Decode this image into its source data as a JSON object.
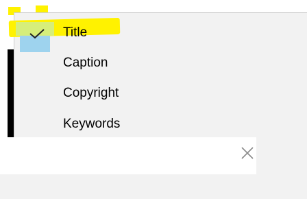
{
  "menu": {
    "items": [
      {
        "label": "Title",
        "checked": true
      },
      {
        "label": "Caption",
        "checked": false
      },
      {
        "label": "Copyright",
        "checked": false
      },
      {
        "label": "Keywords",
        "checked": false
      }
    ]
  },
  "icons": {
    "check": "check-icon",
    "close": "close-icon"
  },
  "colors": {
    "highlight": "#fff200",
    "check_bg": "#9ed3ee",
    "menu_bg": "#f2f2f2"
  }
}
